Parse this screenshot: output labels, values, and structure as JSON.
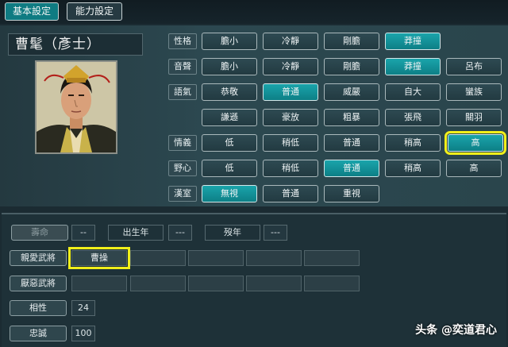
{
  "tabs": [
    {
      "label": "基本設定",
      "active": true
    },
    {
      "label": "能力設定",
      "active": false
    }
  ],
  "officer": {
    "name": "曹髦（彥士）"
  },
  "rows": {
    "personality": {
      "label": "性格",
      "options": [
        "膽小",
        "冷靜",
        "剛膽",
        "莽撞"
      ],
      "selected": 3
    },
    "voice": {
      "label": "音聲",
      "options": [
        "膽小",
        "冷靜",
        "剛膽",
        "莽撞",
        "呂布"
      ],
      "selected": 3
    },
    "tone": {
      "label": "語氣",
      "options": [
        "恭敬",
        "普通",
        "威嚴",
        "自大",
        "蠻族",
        "謙遜",
        "豪放",
        "粗暴",
        "張飛",
        "關羽"
      ],
      "selected": 1
    },
    "loyalty_sense": {
      "label": "情義",
      "options": [
        "低",
        "稍低",
        "普通",
        "稍高",
        "高"
      ],
      "selected": 4
    },
    "ambition": {
      "label": "野心",
      "options": [
        "低",
        "稍低",
        "普通",
        "稍高",
        "高"
      ],
      "selected": 2
    },
    "han": {
      "label": "漢室",
      "options": [
        "無視",
        "普通",
        "重視"
      ],
      "selected": 0
    }
  },
  "lower": {
    "lifespan_label": "壽命",
    "lifespan_value": "--",
    "birth_label": "出生年",
    "birth_value": "---",
    "death_label": "歿年",
    "death_value": "---",
    "liked_label": "親愛武將",
    "liked": [
      "曹操",
      "",
      "",
      "",
      ""
    ],
    "disliked_label": "厭惡武將",
    "disliked": [
      "",
      "",
      "",
      "",
      ""
    ],
    "compat_label": "相性",
    "compat_value": "24",
    "loyalty_label": "忠誠",
    "loyalty_value": "100"
  },
  "colors": {
    "selected": "#0f8a91",
    "highlight": "#f1ef1a",
    "background": "#1b2b32"
  },
  "watermark": "头条 @奕道君心"
}
